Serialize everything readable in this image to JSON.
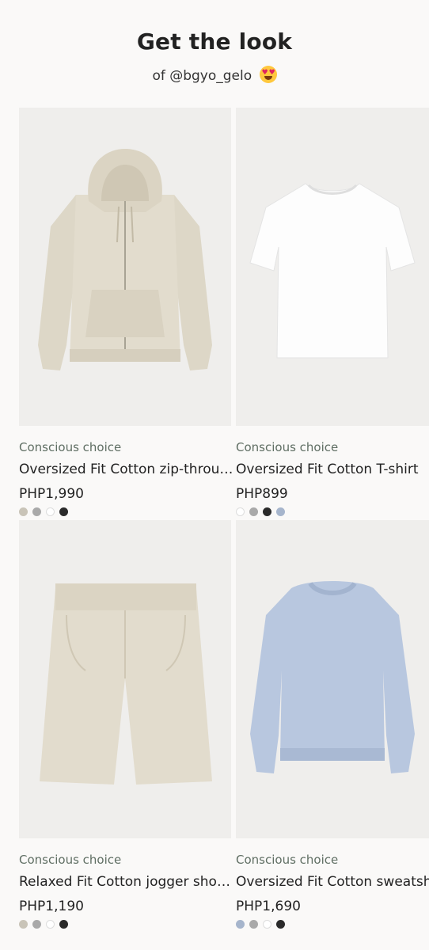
{
  "header": {
    "title": "Get the look",
    "subtitle": "of @bgyo_gelo"
  },
  "products": [
    {
      "tag": "Conscious choice",
      "name": "Oversized Fit Cotton zip-through hoodie",
      "price": "PHP1,990",
      "image": "beige-hoodie",
      "swatches": [
        "#c9c4b8",
        "#a9a9a9",
        "#ffffff",
        "#2a2a2a"
      ]
    },
    {
      "tag": "Conscious choice",
      "name": "Oversized Fit Cotton T-shirt",
      "price": "PHP899",
      "image": "white-tshirt",
      "swatches": [
        "#ffffff",
        "#a9a9a9",
        "#2a2a2a",
        "#a6b5cc"
      ]
    },
    {
      "tag": "Conscious choice",
      "name": "Relaxed Fit Cotton jogger shorts",
      "price": "PHP1,190",
      "image": "beige-shorts",
      "swatches": [
        "#c9c4b8",
        "#a9a9a9",
        "#ffffff",
        "#2a2a2a"
      ]
    },
    {
      "tag": "Conscious choice",
      "name": "Oversized Fit Cotton sweatshirt",
      "price": "PHP1,690",
      "image": "light-blue-sweatshirt",
      "swatches": [
        "#a6b5cc",
        "#a9a9a9",
        "#ffffff",
        "#2a2a2a"
      ]
    }
  ]
}
